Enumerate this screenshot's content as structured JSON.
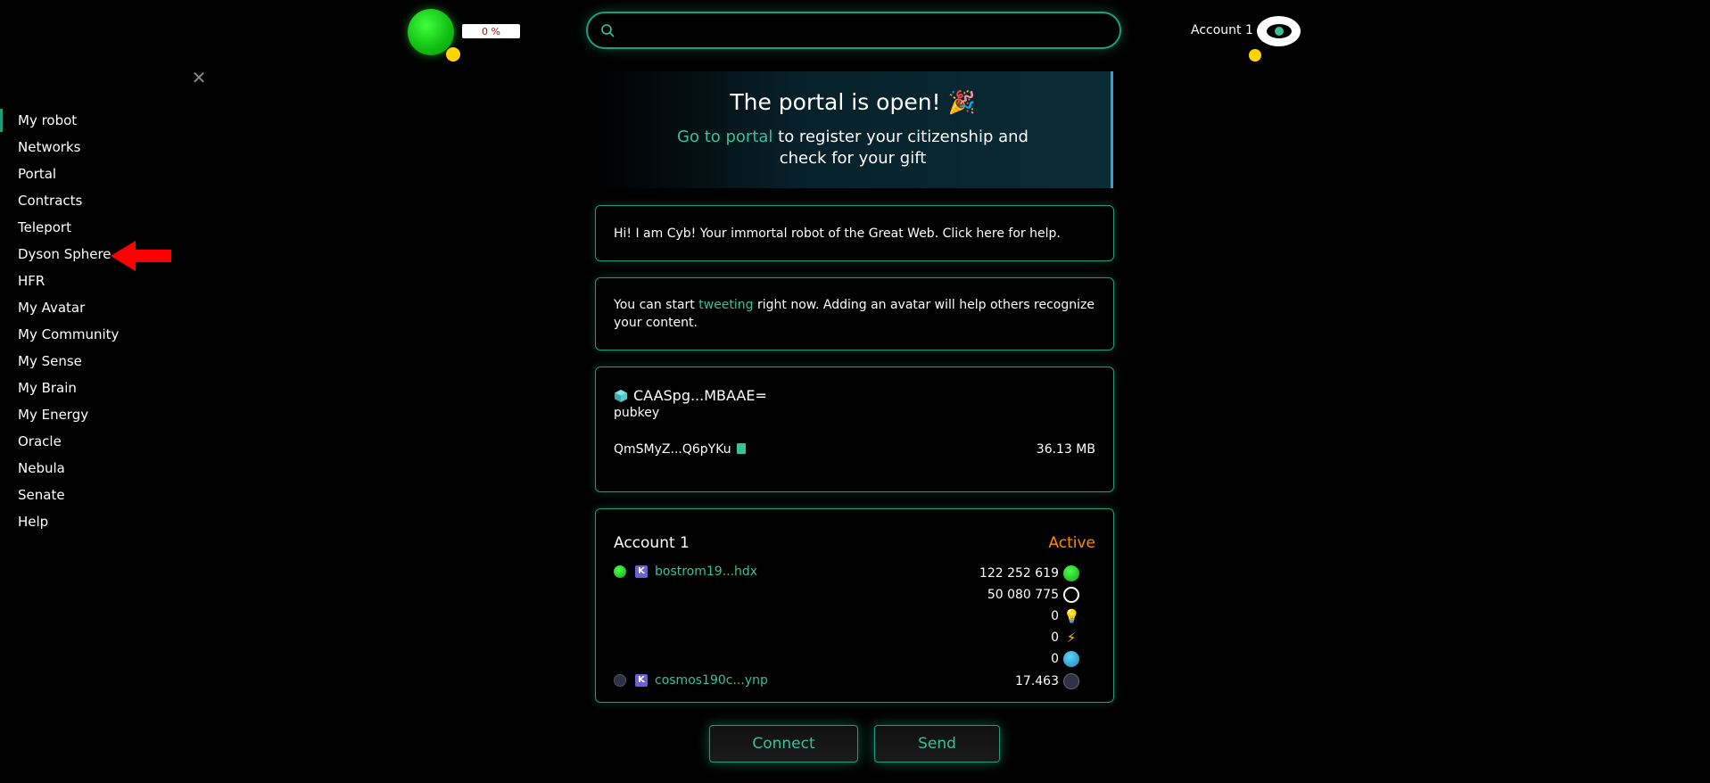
{
  "header": {
    "progress_label": "0 %",
    "search_value": "",
    "account_name": "Account 1"
  },
  "sidebar": {
    "items": [
      {
        "label": "My robot"
      },
      {
        "label": "Networks"
      },
      {
        "label": "Portal"
      },
      {
        "label": "Contracts"
      },
      {
        "label": "Teleport"
      },
      {
        "label": "Dyson Sphere"
      },
      {
        "label": "HFR"
      },
      {
        "label": "My Avatar"
      },
      {
        "label": "My Community"
      },
      {
        "label": "My Sense"
      },
      {
        "label": "My Brain"
      },
      {
        "label": "My Energy"
      },
      {
        "label": "Oracle"
      },
      {
        "label": "Nebula"
      },
      {
        "label": "Senate"
      },
      {
        "label": "Help"
      }
    ],
    "active_index": 0
  },
  "portal_banner": {
    "title": "The portal is open! 🎉",
    "link_text": "Go to portal",
    "text_line1": " to register your citizenship and",
    "text_line2": "check for your gift"
  },
  "cards": {
    "cyb_help": "Hi! I am Cyb! Your immortal robot of the Great Web. Click here for help.",
    "tweet": {
      "before": "You can start ",
      "link": "tweeting",
      "after": " right now. Adding an avatar will help others recognize your content."
    },
    "pubkey": {
      "value": "CAASpg...MBAAE=",
      "label": "pubkey",
      "cid": "QmSMyZ...Q6pYKu",
      "size": "36.13 MB"
    },
    "account": {
      "name": "Account 1",
      "status": "Active",
      "addresses": [
        {
          "address": "bostrom19...hdx"
        },
        {
          "address": "cosmos190c...ynp"
        }
      ],
      "balances": [
        {
          "amount": "122 252 619",
          "icon": "green-orb-icon"
        },
        {
          "amount": "50 080 775",
          "icon": "white-ring-icon"
        },
        {
          "amount": "0",
          "icon": "lightbulb-icon"
        },
        {
          "amount": "0",
          "icon": "lightning-icon"
        },
        {
          "amount": "0",
          "icon": "blue-globe-icon"
        },
        {
          "amount": "17.463",
          "icon": "cosmos-atom-icon"
        }
      ]
    }
  },
  "buttons": {
    "connect": "Connect",
    "send": "Send"
  },
  "colors": {
    "accent": "#33c29a",
    "border": "#1b9f7a",
    "status_active": "#ff8a00",
    "annotation_arrow": "#ff0000"
  }
}
